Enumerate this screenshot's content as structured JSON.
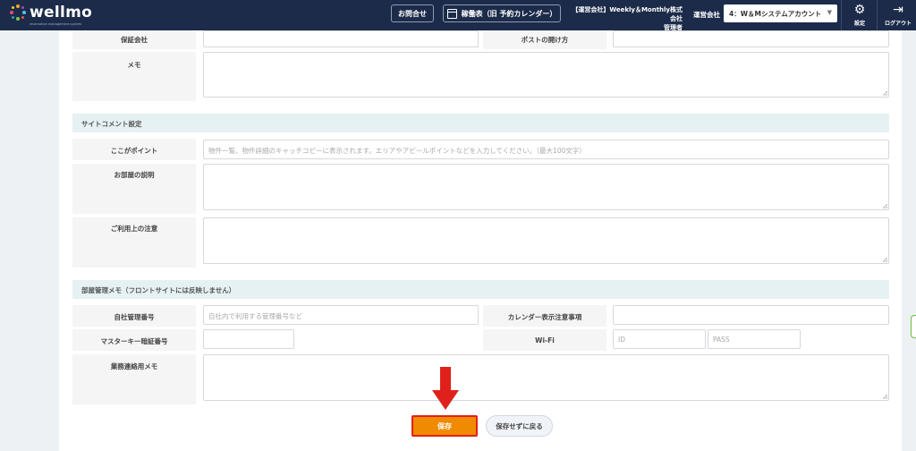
{
  "header": {
    "logo_text": "wellmo",
    "logo_subtitle": "reservation management system",
    "inquiry_label": "お問合せ",
    "calendar_label": "稼働表（旧 予約カレンダー）",
    "company_name": "【運営会社】Weekly＆Monthly株式会社",
    "role": "管理者",
    "operator_label": "運営会社",
    "operator_value": "4：W＆Mシステムアカウント",
    "settings_label": "設定",
    "logout_label": "ログアウト",
    "colors": {
      "background": "#1c2b4a",
      "accent": "#f08a00",
      "highlight": "#e0201a"
    }
  },
  "form": {
    "guarantor": {
      "label": "保証会社",
      "value": ""
    },
    "mailbox": {
      "label": "ポストの開け方",
      "value": ""
    },
    "memo": {
      "label": "メモ",
      "value": ""
    },
    "site_comment": {
      "section_title": "サイトコメント設定",
      "point": {
        "label": "ここがポイント",
        "placeholder": "物件一覧、物件詳細のキャッチコピーに表示されます。エリアやアピールポイントなどを入力してください。（最大100文字）"
      },
      "room_description": {
        "label": "お部屋の説明",
        "value": ""
      },
      "usage_notes": {
        "label": "ご利用上の注意",
        "value": ""
      }
    },
    "room_memo": {
      "section_title": "部屋管理メモ（フロントサイトには反映しません）",
      "internal_number": {
        "label": "自社管理番号",
        "placeholder": "自社内で利用する管理番号など"
      },
      "calendar_note": {
        "label": "カレンダー表示注意事項",
        "value": ""
      },
      "master_key": {
        "label": "マスターキー暗証番号",
        "value": ""
      },
      "wifi": {
        "label": "Wi-Fi",
        "id_placeholder": "ID",
        "pass_placeholder": "PASS"
      },
      "business_memo": {
        "label": "業務連絡用メモ",
        "value": ""
      }
    }
  },
  "actions": {
    "save_label": "保存",
    "back_label": "保存せずに戻る"
  }
}
